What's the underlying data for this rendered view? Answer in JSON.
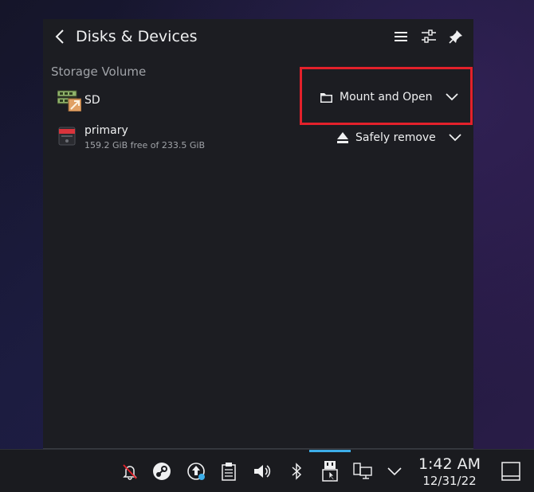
{
  "header": {
    "title": "Disks & Devices"
  },
  "section": {
    "label": "Storage Volume"
  },
  "devices": [
    {
      "name": "SD",
      "subtitle": "",
      "action": "Mount and Open",
      "action_icon": "folder-icon"
    },
    {
      "name": "primary",
      "subtitle": "159.2 GiB free of 233.5 GiB",
      "action": "Safely remove",
      "action_icon": "eject-icon"
    }
  ],
  "taskbar": {
    "time": "1:42 AM",
    "date": "12/31/22"
  },
  "colors": {
    "highlight": "#e3212b",
    "accent": "#3daee9",
    "panel": "#1c1d22"
  }
}
